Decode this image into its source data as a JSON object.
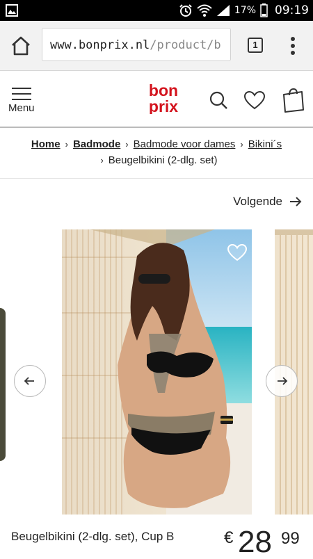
{
  "status_bar": {
    "battery_percent": "17%",
    "time": "09:19",
    "icons": [
      "gallery-icon",
      "alarm-icon",
      "wifi-icon",
      "signal-icon",
      "battery-icon"
    ]
  },
  "browser": {
    "url_host": "www.bonprix.nl",
    "url_path": "/product/b",
    "tab_count": "1",
    "icons": [
      "home-icon",
      "tabs-icon",
      "more-options-icon"
    ]
  },
  "header": {
    "menu_label": "Menu",
    "logo_top": "bon",
    "logo_bottom": "prix",
    "icons": [
      "menu-icon",
      "search-icon",
      "heart-icon",
      "shopping-bag-icon"
    ]
  },
  "breadcrumb": {
    "separator": "›",
    "items": [
      "Home",
      "Badmode",
      "Badmode voor dames",
      "Bikini´s",
      "Beugelbikini (2-dlg. set)"
    ]
  },
  "navigation": {
    "next_label": "Volgende"
  },
  "product": {
    "title": "Beugelbikini (2-dlg. set), Cup B",
    "currency": "€",
    "price_integer": "28",
    "price_decimal": "99"
  },
  "colors": {
    "brand_red": "#d3131d",
    "text": "#222222",
    "chrome_bg": "#f2f2f2"
  }
}
